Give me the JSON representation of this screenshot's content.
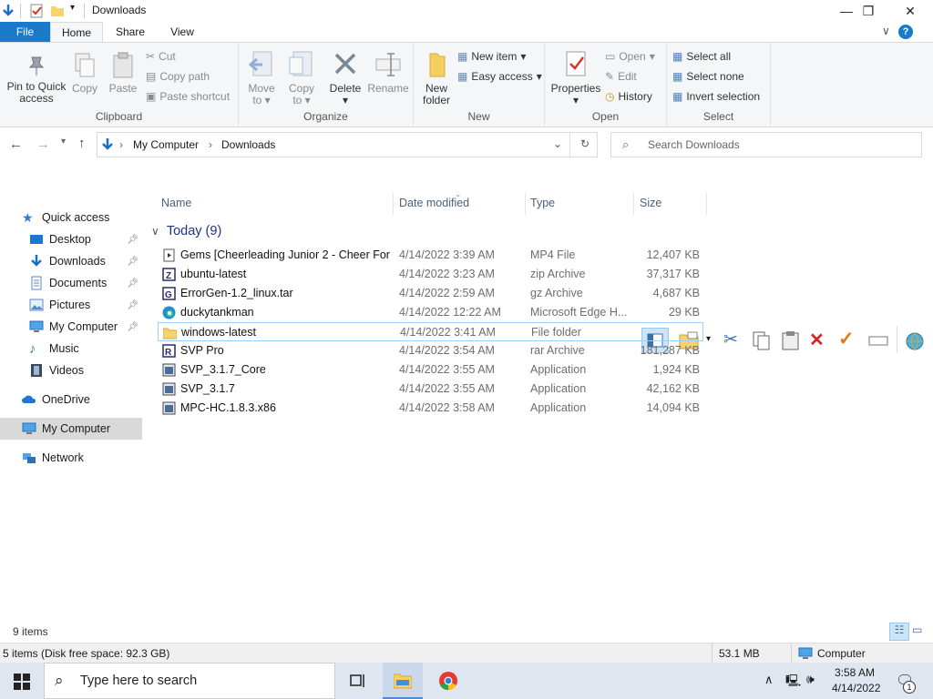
{
  "window": {
    "title": "Downloads"
  },
  "tabs": {
    "file": "File",
    "home": "Home",
    "share": "Share",
    "view": "View"
  },
  "ribbon": {
    "clipboard": {
      "label": "Clipboard",
      "pin_l1": "Pin to Quick",
      "pin_l2": "access",
      "copy": "Copy",
      "paste": "Paste",
      "cut": "Cut",
      "copy_path": "Copy path",
      "paste_shortcut": "Paste shortcut"
    },
    "organize": {
      "label": "Organize",
      "move_l1": "Move",
      "move_l2": "to",
      "copy_l1": "Copy",
      "copy_l2": "to",
      "delete": "Delete",
      "rename": "Rename"
    },
    "new": {
      "label": "New",
      "new_folder_l1": "New",
      "new_folder_l2": "folder",
      "new_item": "New item",
      "easy_access": "Easy access"
    },
    "open": {
      "label": "Open",
      "properties": "Properties",
      "open": "Open",
      "edit": "Edit",
      "history": "History"
    },
    "select": {
      "label": "Select",
      "select_all": "Select all",
      "select_none": "Select none",
      "invert": "Invert selection"
    }
  },
  "address": {
    "crumbs": [
      "My Computer",
      "Downloads"
    ],
    "search_placeholder": "Search Downloads"
  },
  "nav": {
    "quick_access": "Quick access",
    "items": [
      {
        "label": "Desktop",
        "icon": "desktop-icon"
      },
      {
        "label": "Downloads",
        "icon": "downloads-icon"
      },
      {
        "label": "Documents",
        "icon": "documents-icon"
      },
      {
        "label": "Pictures",
        "icon": "pictures-icon"
      },
      {
        "label": "My Computer",
        "icon": "computer-icon"
      },
      {
        "label": "Music",
        "icon": "music-icon"
      },
      {
        "label": "Videos",
        "icon": "videos-icon"
      }
    ],
    "onedrive": "OneDrive",
    "my_computer": "My Computer",
    "network": "Network"
  },
  "columns": {
    "name": "Name",
    "date": "Date modified",
    "type": "Type",
    "size": "Size"
  },
  "group": {
    "label": "Today (9)"
  },
  "files": [
    {
      "name": "Gems  [Cheerleading Junior 2 - Cheer For...",
      "date": "4/14/2022 3:39 AM",
      "type": "MP4 File",
      "size": "12,407 KB",
      "icon": "video-file-icon"
    },
    {
      "name": "ubuntu-latest",
      "date": "4/14/2022 3:23 AM",
      "type": "zip Archive",
      "size": "37,317 KB",
      "icon": "zip-archive-icon"
    },
    {
      "name": "ErrorGen-1.2_linux.tar",
      "date": "4/14/2022 2:59 AM",
      "type": "gz Archive",
      "size": "4,687 KB",
      "icon": "gz-archive-icon"
    },
    {
      "name": "duckytankman",
      "date": "4/14/2022 12:22 AM",
      "type": "Microsoft Edge H...",
      "size": "29 KB",
      "icon": "edge-icon"
    },
    {
      "name": "windows-latest",
      "date": "4/14/2022 3:41 AM",
      "type": "File folder",
      "size": "",
      "icon": "folder-icon"
    },
    {
      "name": "SVP Pro",
      "date": "4/14/2022 3:54 AM",
      "type": "rar Archive",
      "size": "181,287 KB",
      "icon": "rar-archive-icon"
    },
    {
      "name": "SVP_3.1.7_Core",
      "date": "4/14/2022 3:55 AM",
      "type": "Application",
      "size": "1,924 KB",
      "icon": "application-icon"
    },
    {
      "name": "SVP_3.1.7",
      "date": "4/14/2022 3:55 AM",
      "type": "Application",
      "size": "42,162 KB",
      "icon": "application-icon"
    },
    {
      "name": "MPC-HC.1.8.3.x86",
      "date": "4/14/2022 3:58 AM",
      "type": "Application",
      "size": "14,094 KB",
      "icon": "application-icon"
    }
  ],
  "status": {
    "items": "9 items",
    "disk": "5 items (Disk free space: 92.3 GB)",
    "size": "53.1 MB",
    "location": "Computer"
  },
  "taskbar": {
    "search_placeholder": "Type here to search",
    "time": "3:58 AM",
    "date": "4/14/2022",
    "notif_count": "1"
  },
  "colors": {
    "accent": "#1979ca",
    "selection_border": "#99d1ff",
    "taskbar": "#dfe6ef"
  }
}
